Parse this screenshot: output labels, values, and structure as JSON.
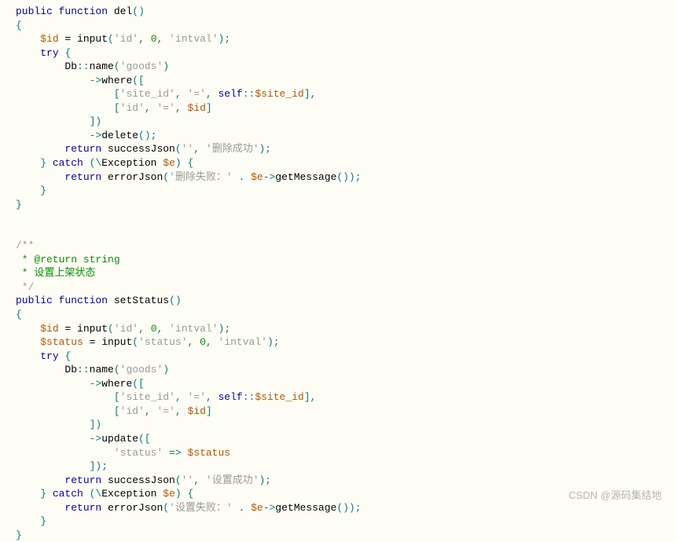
{
  "code": {
    "fn1_decl": {
      "public": "public",
      "function": "function",
      "name": "del"
    },
    "line_id": {
      "var": "$id",
      "eq": " = ",
      "call": "input",
      "args_open": "(",
      "s1": "'id'",
      "c1": ", ",
      "n": "0",
      "c2": ", ",
      "s2": "'intval'",
      "args_close": ")",
      "semi": ";"
    },
    "try": "try",
    "dbname": {
      "db": "Db",
      "sep": "::",
      "name": "name",
      "open": "(",
      "arg": "'goods'",
      "close": ")"
    },
    "where": {
      "arrow": "->",
      "call": "where",
      "open": "(["
    },
    "where_row1": {
      "open": "[",
      "s1": "'site_id'",
      "c1": ", ",
      "s2": "'='",
      "c2": ", ",
      "self": "self",
      "sep": "::",
      "var": "$site_id",
      "close": "],"
    },
    "where_row2": {
      "open": "[",
      "s1": "'id'",
      "c1": ", ",
      "s2": "'='",
      "c2": ", ",
      "var": "$id",
      "close": "]"
    },
    "where_close": "])",
    "delete": {
      "arrow": "->",
      "call": "delete",
      "parens": "();"
    },
    "return1": {
      "ret": "return",
      "call": " successJson",
      "open": "(",
      "s1": "''",
      "c": ", ",
      "s2": "'删除成功'",
      "close": ");"
    },
    "catch": {
      "close": "}",
      "catch": " catch ",
      "open": "(\\",
      "exc": "Exception ",
      "var": "$e",
      "close2": ") {"
    },
    "return_err": {
      "ret": "return",
      "call": " errorJson",
      "open": "(",
      "s1": "'删除失败：'",
      "c": " . ",
      "var": "$e",
      "arrow": "->",
      "m": "getMessage",
      "close": "());"
    },
    "doc_open": "/**",
    "doc_return": " * @return string",
    "doc_desc": " * 设置上架状态",
    "doc_close": " */",
    "fn2_decl": {
      "public": "public",
      "function": "function",
      "name": "setStatus"
    },
    "line_status": {
      "var": "$status",
      "eq": " = ",
      "call": "input",
      "args_open": "(",
      "s1": "'status'",
      "c1": ", ",
      "n": "0",
      "c2": ", ",
      "s2": "'intval'",
      "args_close": ")",
      "semi": ";"
    },
    "update": {
      "arrow": "->",
      "call": "update",
      "open": "(["
    },
    "update_row": {
      "s1": "'status'",
      "arrow": " => ",
      "var": "$status"
    },
    "update_close": "]);",
    "return2": {
      "ret": "return",
      "call": " successJson",
      "open": "(",
      "s1": "''",
      "c": ", ",
      "s2": "'设置成功'",
      "close": ");"
    },
    "return_err2": {
      "ret": "return",
      "call": " errorJson",
      "open": "(",
      "s1": "'设置失败：'",
      "c": " . ",
      "var": "$e",
      "arrow": "->",
      "m": "getMessage",
      "close": "());"
    }
  },
  "watermark": "CSDN @源码集结地"
}
